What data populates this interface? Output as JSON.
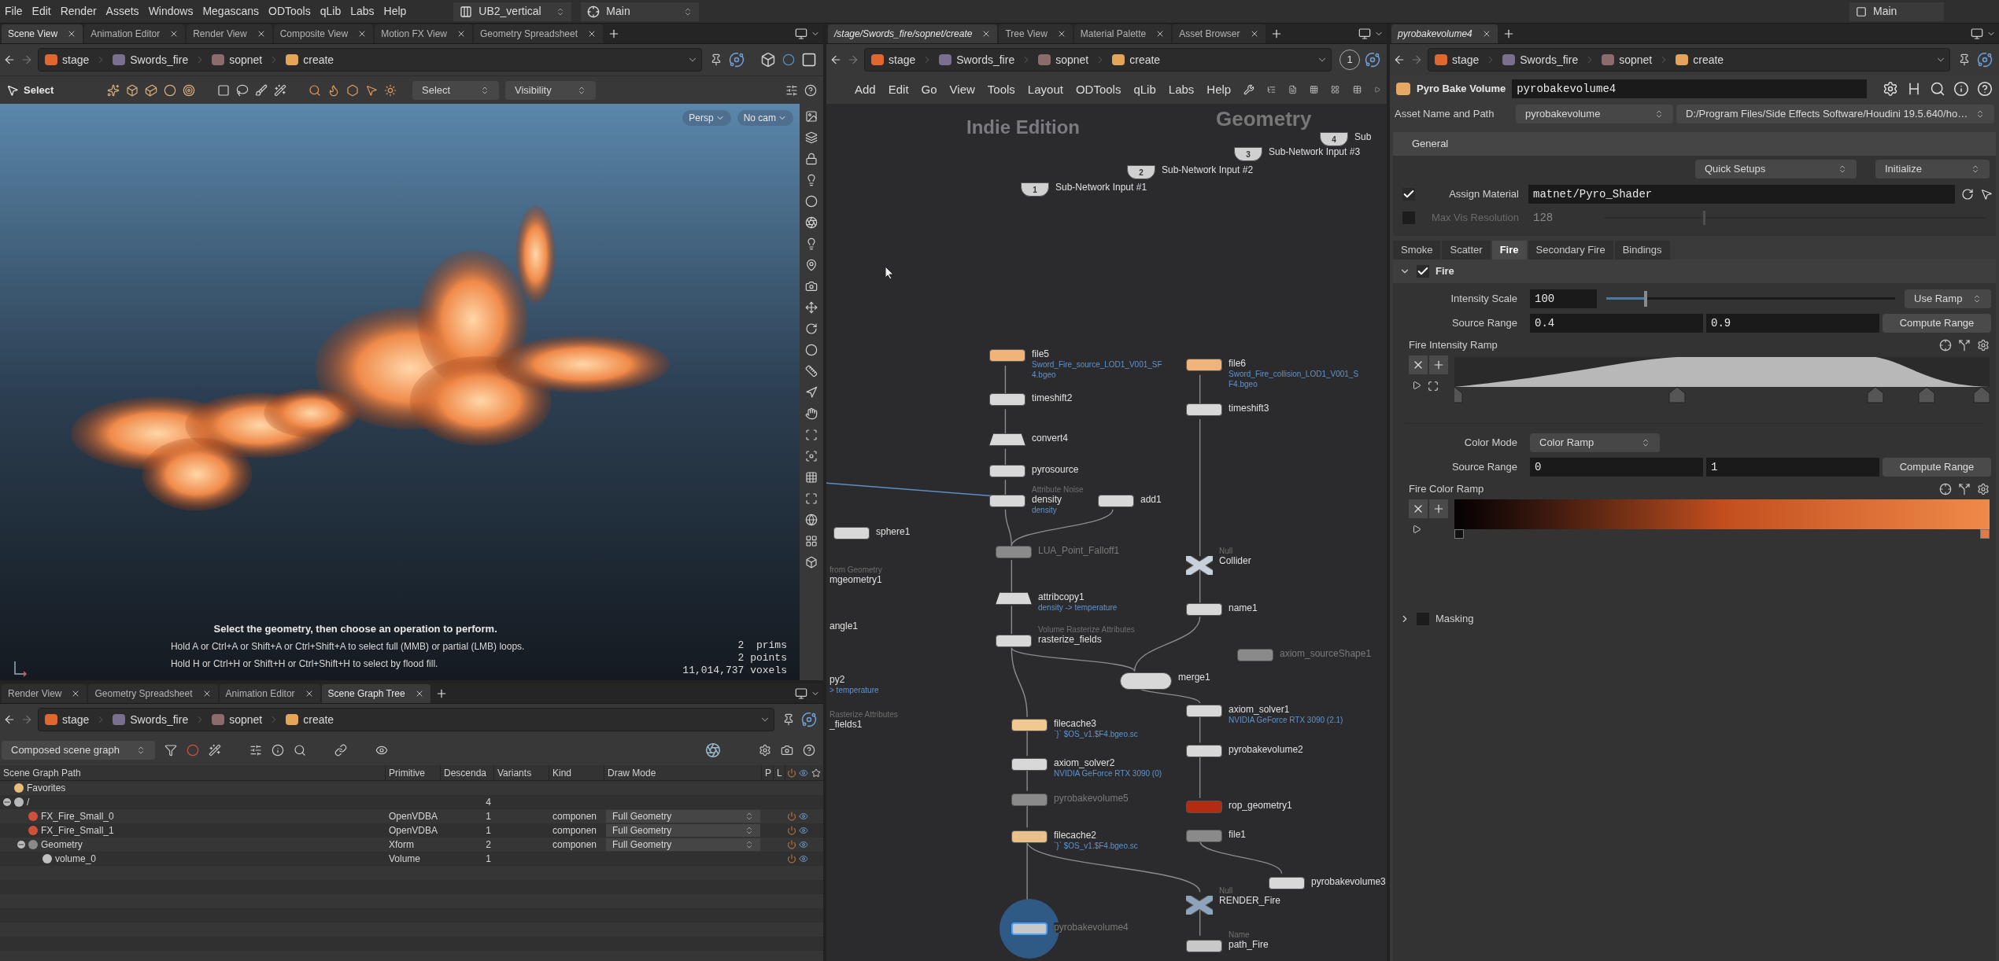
{
  "menu_bar": {
    "items": [
      "File",
      "Edit",
      "Render",
      "Assets",
      "Windows",
      "Megascans",
      "ODTools",
      "qLib",
      "Labs",
      "Help"
    ],
    "desktop": "UB2_vertical",
    "viewport": "Main",
    "session": "Main"
  },
  "scene_view_pane": {
    "tabs": [
      {
        "label": "Scene View",
        "selected": true
      },
      {
        "label": "Animation Editor",
        "selected": false
      },
      {
        "label": "Render View",
        "selected": false
      },
      {
        "label": "Composite View",
        "selected": false
      },
      {
        "label": "Motion FX View",
        "selected": false
      },
      {
        "label": "Geometry Spreadsheet",
        "selected": false
      }
    ],
    "path": [
      {
        "label": "stage",
        "kind": "stage"
      },
      {
        "label": "Swords_fire",
        "kind": "object"
      },
      {
        "label": "sopnet",
        "kind": "sopnet"
      },
      {
        "label": "create",
        "kind": "sop"
      }
    ],
    "toolbar": {
      "tool": "Select",
      "select_mode": "Select",
      "visibility": "Visibility"
    },
    "viewport": {
      "camera_buttons": [
        "Persp",
        "No cam"
      ],
      "hint_title": "Select the geometry, then choose an operation to perform.",
      "hint_lines": [
        "Hold A or Ctrl+A or Shift+A or Ctrl+Shift+A to select full (MMB) or partial (LMB) loops.",
        "Hold H or Ctrl+H or Shift+H or Ctrl+Shift+H to select by flood fill."
      ],
      "stats": [
        "2  prims",
        "2 points",
        "11,014,737 voxels"
      ]
    }
  },
  "scene_graph_pane": {
    "tabs": [
      {
        "label": "Render View",
        "selected": false
      },
      {
        "label": "Geometry Spreadsheet",
        "selected": false
      },
      {
        "label": "Animation Editor",
        "selected": false
      },
      {
        "label": "Scene Graph Tree",
        "selected": true
      }
    ],
    "path": [
      {
        "label": "stage",
        "kind": "stage"
      },
      {
        "label": "Swords_fire",
        "kind": "object"
      },
      {
        "label": "sopnet",
        "kind": "sopnet"
      },
      {
        "label": "create",
        "kind": "sop"
      }
    ],
    "mode": "Composed scene graph",
    "columns": [
      "Scene Graph Path",
      "Primitive",
      "Descenda",
      "Variants",
      "Kind",
      "Draw Mode",
      "P",
      "L"
    ],
    "rows": [
      {
        "name": "Favorites",
        "kind": "favorites"
      },
      {
        "name": "/",
        "kind": "root",
        "descendants": "4",
        "expanded": true,
        "children": [
          {
            "name": "FX_Fire_Small_0",
            "kind": "volume",
            "primitive": "OpenVDBA",
            "descendants": "1",
            "model_kind": "componen",
            "draw_mode": "Full Geometry"
          },
          {
            "name": "FX_Fire_Small_1",
            "kind": "volume",
            "primitive": "OpenVDBA",
            "descendants": "1",
            "model_kind": "componen",
            "draw_mode": "Full Geometry"
          },
          {
            "name": "Geometry",
            "kind": "xform",
            "primitive": "Xform",
            "descendants": "2",
            "model_kind": "componen",
            "draw_mode": "Full Geometry",
            "expanded": true,
            "children": [
              {
                "name": "volume_0",
                "kind": "mesh",
                "primitive": "Volume",
                "descendants": "1"
              }
            ]
          }
        ]
      }
    ]
  },
  "network_pane": {
    "tabs": [
      {
        "label": "/stage/Swords_fire/sopnet/create",
        "selected": true
      },
      {
        "label": "Tree View",
        "selected": false
      },
      {
        "label": "Material Palette",
        "selected": false
      },
      {
        "label": "Asset Browser",
        "selected": false
      }
    ],
    "path": [
      {
        "label": "stage",
        "kind": "stage"
      },
      {
        "label": "Swords_fire",
        "kind": "object"
      },
      {
        "label": "sopnet",
        "kind": "sopnet"
      },
      {
        "label": "create",
        "kind": "sop"
      }
    ],
    "viewer_number": "1",
    "menu": [
      "Add",
      "Edit",
      "Go",
      "View",
      "Tools",
      "Layout",
      "ODTools",
      "qLib",
      "Labs",
      "Help"
    ],
    "edition_label": "Indie Edition",
    "context_label": "Geometry",
    "nodes": [
      {
        "name": "Sub",
        "kind": "input",
        "badge": "4",
        "color": "#d0d0d0",
        "selected": false,
        "faded": false
      },
      {
        "name": "Sub-Network Input #3",
        "kind": "input",
        "badge": "3",
        "color": "#d0d0d0",
        "selected": false,
        "faded": false
      },
      {
        "name": "Sub-Network Input #2",
        "kind": "input",
        "badge": "2",
        "color": "#d0d0d0",
        "selected": false,
        "faded": false
      },
      {
        "name": "Sub-Network Input #1",
        "kind": "input",
        "badge": "1",
        "color": "#d0d0d0",
        "selected": false,
        "faded": false
      },
      {
        "name": "file5",
        "kind": "sop",
        "color": "#f0b47a",
        "selected": false,
        "faded": false,
        "details": [
          "Sword_Fire_source_LOD1_V001_SF",
          "4.bgeo"
        ]
      },
      {
        "name": "file6",
        "kind": "sop",
        "color": "#f0b47a",
        "selected": false,
        "faded": false,
        "details": [
          "Sword_Fire_collision_LOD1_V001_S",
          "F4.bgeo"
        ]
      },
      {
        "name": "timeshift2",
        "kind": "sop",
        "color": "#d8d8d8",
        "selected": false,
        "faded": false
      },
      {
        "name": "timeshift3",
        "kind": "sop",
        "color": "#d8d8d8",
        "selected": false,
        "faded": false
      },
      {
        "name": "convert4",
        "kind": "trapezoid",
        "color": "#d8d8d8",
        "selected": false,
        "faded": false
      },
      {
        "name": "pyrosource",
        "kind": "sop",
        "color": "#d8d8d8",
        "selected": false,
        "faded": false
      },
      {
        "name": "density",
        "type_label": "Attribute Noise",
        "kind": "sop",
        "color": "#d8d8d8",
        "selected": false,
        "faded": false,
        "details": [
          "density"
        ]
      },
      {
        "name": "add1",
        "kind": "sop",
        "color": "#d8d8d8",
        "selected": false,
        "faded": false
      },
      {
        "name": "sphere1",
        "kind": "sop",
        "color": "#d8d8d8",
        "selected": false,
        "faded": false
      },
      {
        "name": "LUA_Point_Falloff1",
        "kind": "sop",
        "color": "#8a8a8a",
        "selected": false,
        "faded": true
      },
      {
        "name": "Collider",
        "type_label": "Null",
        "kind": "null",
        "color": "#c8d0dc",
        "selected": false,
        "faded": false
      },
      {
        "name": "attribcopy1",
        "kind": "trapezoid",
        "color": "#d8d8d8",
        "selected": false,
        "faded": false,
        "details": [
          "density -> temperature"
        ]
      },
      {
        "name": "name1",
        "kind": "sop",
        "color": "#d8d8d8",
        "selected": false,
        "faded": false
      },
      {
        "name": "rasterize_fields",
        "type_label": "Volume Rasterize Attributes",
        "kind": "sop",
        "color": "#d8d8d8",
        "selected": false,
        "faded": false
      },
      {
        "name": "axiom_sourceShape1",
        "kind": "sop",
        "color": "#8a8a8a",
        "selected": false,
        "faded": true
      },
      {
        "name": "merge1",
        "kind": "merge",
        "color": "#d8d8d8",
        "selected": false,
        "faded": false
      },
      {
        "name": "filecache3",
        "kind": "sop",
        "color": "#f0c890",
        "selected": false,
        "faded": false,
        "details": [
          "`}` $OS_v1.$F4.bgeo.sc"
        ]
      },
      {
        "name": "axiom_solver1",
        "kind": "sop",
        "color": "#d8d8d8",
        "selected": false,
        "faded": false,
        "details": [
          "NVIDIA GeForce RTX 3090 (2.1)"
        ]
      },
      {
        "name": "axiom_solver2",
        "kind": "sop",
        "color": "#d8d8d8",
        "selected": false,
        "faded": false,
        "details": [
          "NVIDIA GeForce RTX 3090 (0)"
        ]
      },
      {
        "name": "pyrobakevolume2",
        "kind": "sop",
        "color": "#d8d8d8",
        "selected": false,
        "faded": false
      },
      {
        "name": "pyrobakevolume5",
        "kind": "sop",
        "color": "#8a8a8a",
        "selected": false,
        "faded": true
      },
      {
        "name": "rop_geometry1",
        "kind": "sop",
        "color": "#b42c10",
        "selected": false,
        "faded": false
      },
      {
        "name": "filecache2",
        "kind": "sop",
        "color": "#e8c08a",
        "selected": false,
        "faded": false,
        "details": [
          "`}` $OS_v1.$F4.bgeo.sc"
        ]
      },
      {
        "name": "file1",
        "kind": "sop",
        "color": "#8a8a8a",
        "selected": false,
        "faded": false
      },
      {
        "name": "pyrobakevolume3",
        "kind": "sop",
        "color": "#d8d8d8",
        "selected": false,
        "faded": false
      },
      {
        "name": "RENDER_Fire",
        "type_label": "Null",
        "kind": "null",
        "color": "#8ea4bc",
        "selected": false,
        "faded": false
      },
      {
        "name": "pyrobakevolume4",
        "kind": "sop",
        "color": "#c8c8c8",
        "selected": true,
        "faded": true
      },
      {
        "name": "path_Fire",
        "type_label": "Name",
        "kind": "sop",
        "color": "#c8c8c8",
        "selected": false,
        "faded": false
      },
      {
        "name": "mgeometry1",
        "type_label": "from Geometry",
        "kind": "clipped",
        "selected": false,
        "faded": false
      },
      {
        "name": "angle1",
        "kind": "clipped",
        "selected": false,
        "faded": false
      },
      {
        "name": "py2",
        "kind": "clipped",
        "selected": false,
        "faded": false,
        "details": [
          "> temperature"
        ]
      },
      {
        "name": "_fields1",
        "type_label": "Rasterize Attributes",
        "kind": "clipped",
        "selected": false,
        "faded": false
      }
    ]
  },
  "parameter_pane": {
    "tabs": [
      {
        "label": "pyrobakevolume4",
        "selected": true
      }
    ],
    "path": [
      {
        "label": "stage",
        "kind": "stage"
      },
      {
        "label": "Swords_fire",
        "kind": "object"
      },
      {
        "label": "sopnet",
        "kind": "sopnet"
      },
      {
        "label": "create",
        "kind": "sop"
      }
    ],
    "node_type": "Pyro Bake Volume",
    "node_name": "pyrobakevolume4",
    "asset_label": "Asset Name and Path",
    "asset_name": "pyrobakevolume",
    "asset_path": "D:/Program Files/Side Effects Software/Houdini 19.5.640/ho…",
    "folder_tab": "General",
    "quick_setups": "Quick Setups",
    "initialize": "Initialize",
    "assign_material": {
      "label": "Assign Material",
      "checked": true,
      "value": "matnet/Pyro_Shader"
    },
    "max_vis_resolution": {
      "label": "Max Vis Resolution",
      "checked": false,
      "value": "128",
      "level": 0.26
    },
    "section_tabs": [
      {
        "label": "Smoke",
        "selected": false
      },
      {
        "label": "Scatter",
        "selected": false
      },
      {
        "label": "Fire",
        "selected": true
      },
      {
        "label": "Secondary Fire",
        "selected": false
      },
      {
        "label": "Bindings",
        "selected": false
      }
    ],
    "fire": {
      "label": "Fire",
      "expanded": true,
      "checked": true,
      "intensity_scale": {
        "label": "Intensity Scale",
        "value": "100",
        "level": 0.13
      },
      "use_ramp": "Use Ramp",
      "source_range": {
        "label": "Source Range",
        "min": "0.4",
        "max": "0.9",
        "button": "Compute Range"
      },
      "intensity_ramp_label": "Fire Intensity Ramp",
      "color_mode": {
        "label": "Color Mode",
        "value": "Color Ramp"
      },
      "color_source_range": {
        "label": "Source Range",
        "min": "0",
        "max": "1",
        "button": "Compute Range"
      },
      "color_ramp_label": "Fire Color Ramp"
    },
    "masking": {
      "label": "Masking",
      "expanded": false,
      "checked": false
    }
  }
}
